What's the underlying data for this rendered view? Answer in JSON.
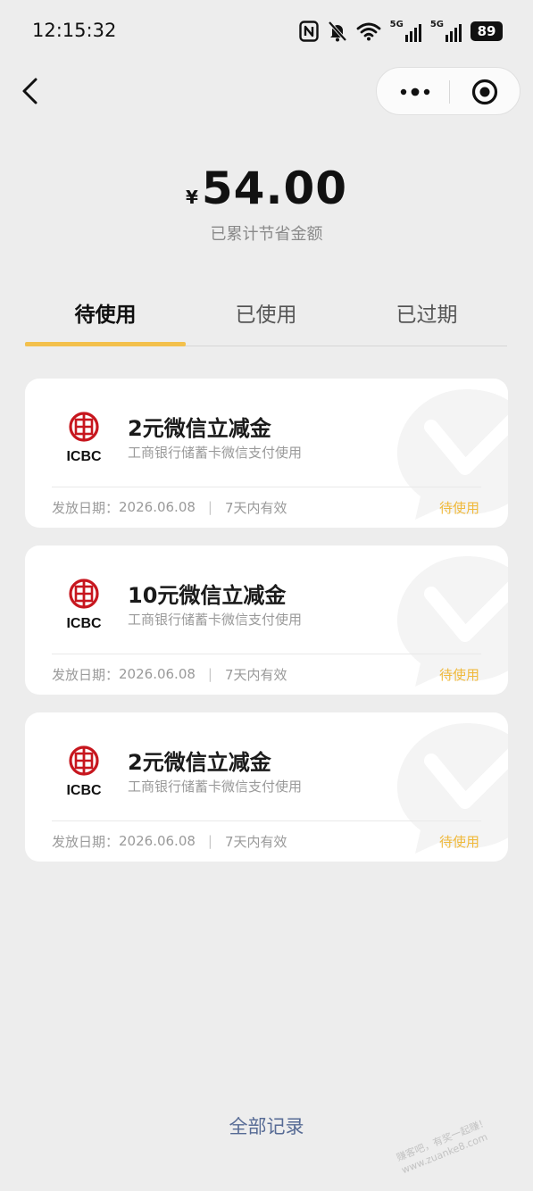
{
  "status_bar": {
    "time": "12:15:32",
    "icons": [
      "nfc-icon",
      "mute-bell-icon",
      "wifi-icon",
      "signal-5g-icon",
      "signal-5g-icon"
    ],
    "signal_label": "5G",
    "battery": "89"
  },
  "nav": {
    "back_icon": "back-chevron-icon",
    "capsule_icons": [
      "more-icon",
      "close-target-icon"
    ]
  },
  "summary": {
    "currency": "¥",
    "amount": "54.00",
    "label": "已累计节省金额"
  },
  "tabs": [
    {
      "label": "待使用",
      "active": true
    },
    {
      "label": "已使用",
      "active": false
    },
    {
      "label": "已过期",
      "active": false
    }
  ],
  "coupons": [
    {
      "bank": "ICBC",
      "title": "2元微信立减金",
      "subtitle": "工商银行储蓄卡微信支付使用",
      "issue_label": "发放日期：",
      "issue_date": "2026.06.08",
      "validity": "7天内有效",
      "status": "待使用"
    },
    {
      "bank": "ICBC",
      "title": "10元微信立减金",
      "subtitle": "工商银行储蓄卡微信支付使用",
      "issue_label": "发放日期：",
      "issue_date": "2026.06.08",
      "validity": "7天内有效",
      "status": "待使用"
    },
    {
      "bank": "ICBC",
      "title": "2元微信立减金",
      "subtitle": "工商银行储蓄卡微信支付使用",
      "issue_label": "发放日期：",
      "issue_date": "2026.06.08",
      "validity": "7天内有效",
      "status": "待使用"
    }
  ],
  "footer": {
    "all_records": "全部记录",
    "site_stamp": "赚客吧，有奖一起赚！ www.zuanke8.com"
  },
  "colors": {
    "background": "#ededed",
    "accent_yellow": "#f3c04c",
    "status_yellow": "#f0b93a",
    "link_blue": "#576b95",
    "icbc_red": "#c7161e"
  }
}
